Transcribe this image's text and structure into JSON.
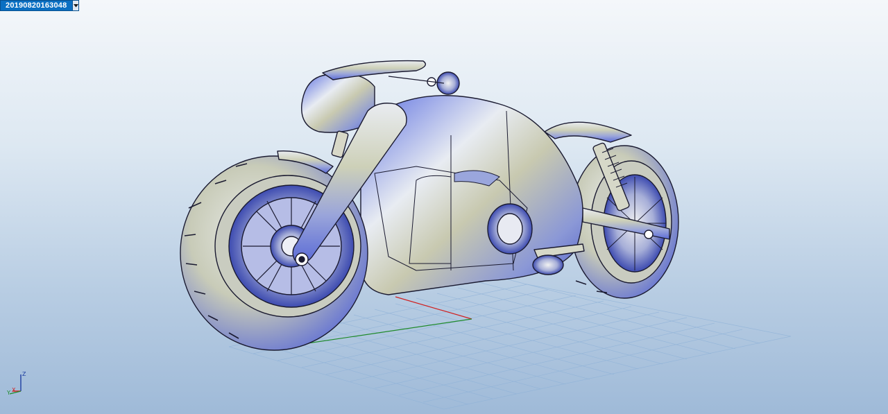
{
  "document_tab": {
    "label": "20190820163048"
  },
  "triad": {
    "z_label": "Z",
    "x_label": "X",
    "y_label": "Y"
  },
  "icons": {
    "dropdown": "chevron-down-icon",
    "triad": "coordinate-axes-icon"
  },
  "colors": {
    "tab_background": "#0a6fc2",
    "x_axis": "#d02020",
    "y_axis": "#1f8a2a",
    "z_axis": "#1e3ea0",
    "grid": "#8fb2d8",
    "model_outline": "#1a1a30"
  }
}
